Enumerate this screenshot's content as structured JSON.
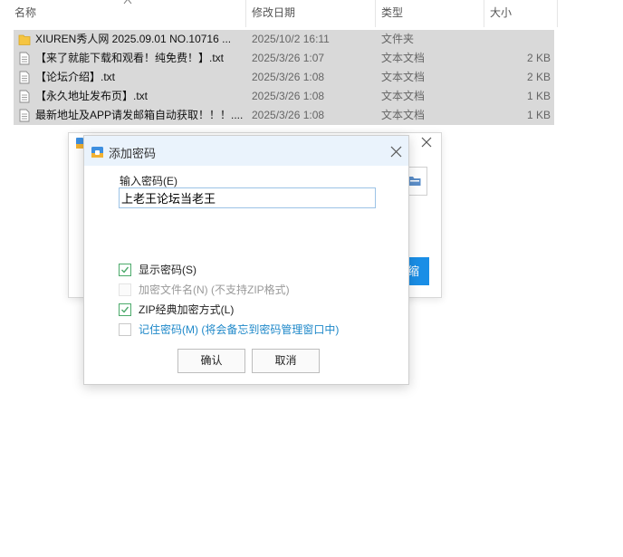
{
  "explorer": {
    "columns": {
      "name": "名称",
      "date": "修改日期",
      "type": "类型",
      "size": "大小"
    },
    "files": [
      {
        "icon": "folder-icon",
        "name": "XIUREN秀人网 2025.09.01 NO.10716 ...",
        "date": "2025/10/2 16:11",
        "type": "文件夹",
        "size": ""
      },
      {
        "icon": "text-file-icon",
        "name": "【来了就能下载和观看！纯免费！】.txt",
        "date": "2025/3/26 1:07",
        "type": "文本文档",
        "size": "2 KB"
      },
      {
        "icon": "text-file-icon",
        "name": "【论坛介绍】.txt",
        "date": "2025/3/26 1:08",
        "type": "文本文档",
        "size": "2 KB"
      },
      {
        "icon": "text-file-icon",
        "name": "【永久地址发布页】.txt",
        "date": "2025/3/26 1:08",
        "type": "文本文档",
        "size": "1 KB"
      },
      {
        "icon": "text-file-icon",
        "name": "最新地址及APP请发邮箱自动获取！！！....",
        "date": "2025/3/26 1:08",
        "type": "文本文档",
        "size": "1 KB"
      }
    ]
  },
  "background_dialog": {
    "button_partial_label": "缩"
  },
  "dialog": {
    "title": "添加密码",
    "input_label": "输入密码(E)",
    "password_value": "上老王论坛当老王",
    "options": {
      "show_password": {
        "label": "显示密码(S)",
        "checked": true
      },
      "encrypt_filenames": {
        "label": "加密文件名(N) (不支持ZIP格式)",
        "checked": false,
        "disabled": true
      },
      "zip_classic": {
        "label": "ZIP经典加密方式(L)",
        "checked": true
      },
      "remember_password": {
        "label": "记住密码(M) (将会备忘到密码管理窗口中)",
        "checked": false
      }
    },
    "ok_label": "确认",
    "cancel_label": "取消"
  },
  "colors": {
    "accent": "#1a8ee6",
    "check": "#4caa6b",
    "titlebar": "#eaf3fc",
    "selection": "#d9d9d9",
    "link": "#1e88c9"
  }
}
